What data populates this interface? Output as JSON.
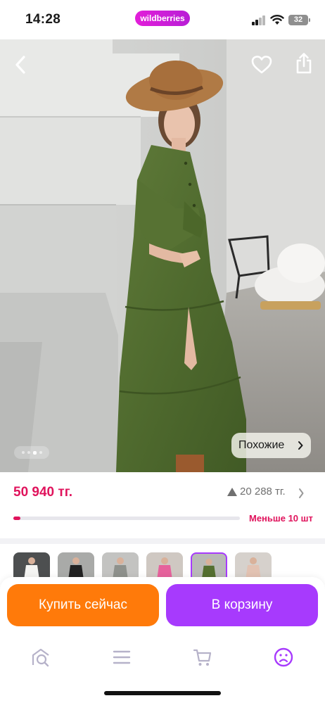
{
  "status_bar": {
    "time": "14:28",
    "brand": "wildberries",
    "battery": "32",
    "signal_icon": "cellular-signal-icon",
    "wifi_icon": "wifi-icon"
  },
  "product_image": {
    "back_icon": "chevron-left-icon",
    "favorite_icon": "heart-icon",
    "share_icon": "share-icon",
    "gallery_dots": 4,
    "gallery_active_dot": 3,
    "similar_button_label": "Похожие"
  },
  "price": {
    "current": "50 940 тг.",
    "secondary": "20 288 тг.",
    "stock_label": "Меньше 10 шт",
    "stock_fraction": 0.03
  },
  "variants": {
    "thumbnails": [
      {
        "name": "white-dress"
      },
      {
        "name": "black-dress"
      },
      {
        "name": "grey-dress"
      },
      {
        "name": "pink-dress"
      },
      {
        "name": "green-dress",
        "selected": true
      },
      {
        "name": "beige-dress"
      }
    ]
  },
  "actions": {
    "buy_now": "Купить сейчас",
    "add_to_cart": "В корзину"
  },
  "bottom_nav": {
    "items": [
      "home-icon",
      "catalog-icon",
      "cart-icon",
      "profile-icon"
    ],
    "active": "profile-icon"
  },
  "colors": {
    "price": "#e0135c",
    "buy_now": "#ff7a0a",
    "add_to_cart": "#a73afd",
    "brand": "#cb11ab"
  }
}
